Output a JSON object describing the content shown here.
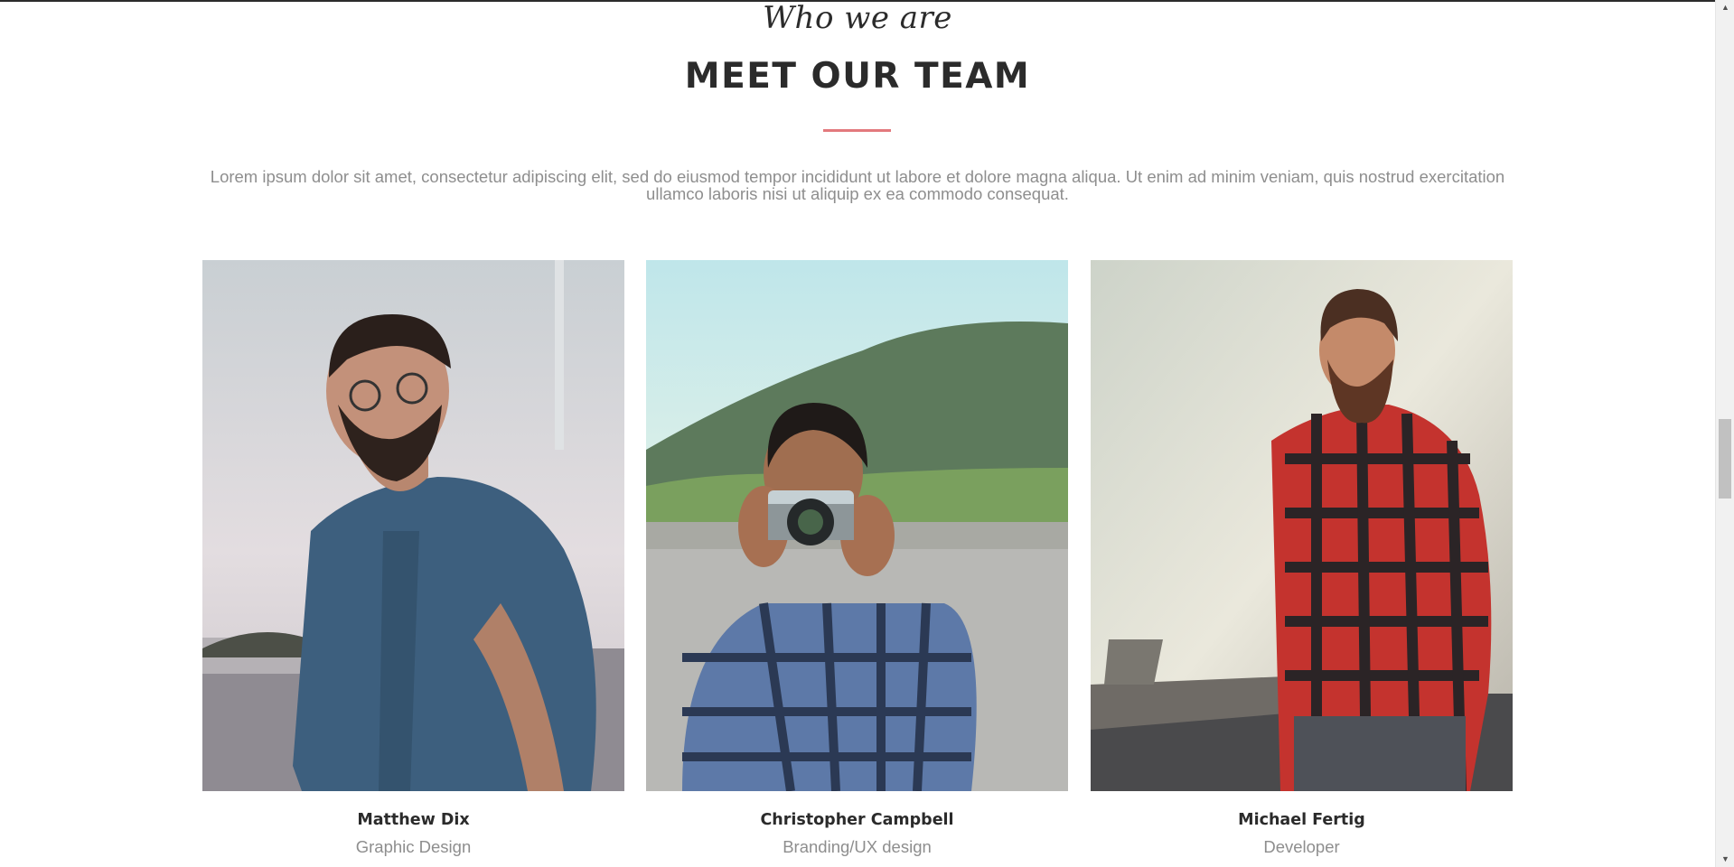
{
  "section": {
    "kicker": "Who we are",
    "title": "MEET OUR TEAM",
    "intro": "Lorem ipsum dolor sit amet, consectetur adipiscing elit, sed do eiusmod tempor incididunt ut labore et dolore magna aliqua. Ut enim ad minim veniam, quis nostrud exercitation ullamco laboris nisi ut aliquip ex ea commodo consequat."
  },
  "team": [
    {
      "name": "Matthew Dix",
      "role": "Graphic Design"
    },
    {
      "name": "Christopher Campbell",
      "role": "Branding/UX design"
    },
    {
      "name": "Michael Fertig",
      "role": "Developer"
    }
  ],
  "scrollbar": {
    "up_icon": "arrow-up-icon",
    "down_icon": "arrow-down-icon"
  },
  "colors": {
    "accent": "#e3797d",
    "heading": "#2b2b2b",
    "muted": "#8e8e8e"
  }
}
